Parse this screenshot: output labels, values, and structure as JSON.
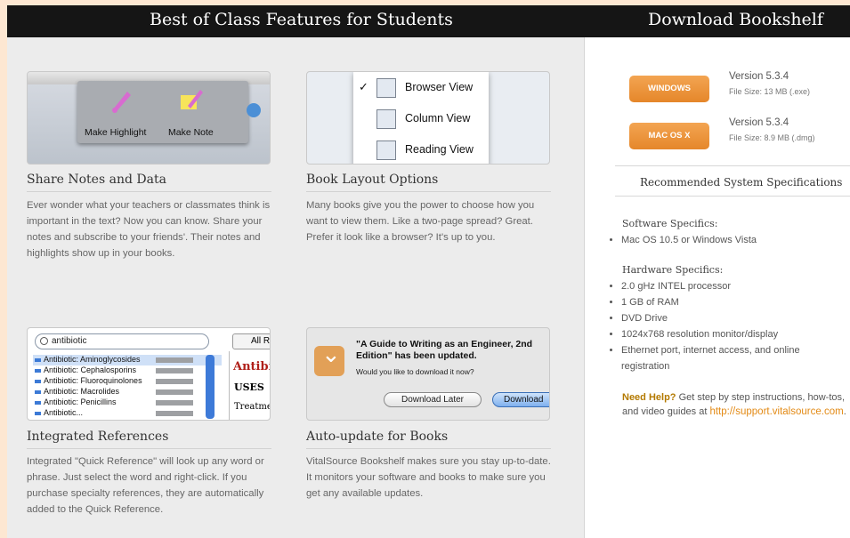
{
  "header": {
    "left_title": "Best of Class Features for Students",
    "right_title": "Download Bookshelf"
  },
  "features": [
    {
      "title": "Share Notes and Data",
      "description": "Ever wonder what your teachers or classmates think is important in the text? Now you can know. Share your notes and subscribe to your friends'. Their notes and highlights show up in your books.",
      "thumb": {
        "highlight_label": "Make Highlight",
        "note_label": "Make Note"
      }
    },
    {
      "title": "Book Layout Options",
      "description": "Many books give you the power to choose how you want to view them. Like a two-page spread? Great. Prefer it look like a browser? It's up to you.",
      "thumb": {
        "check": "✓",
        "items": [
          "Browser View",
          "Column View",
          "Reading View"
        ]
      }
    },
    {
      "title": "Integrated References",
      "description": "Integrated \"Quick Reference\" will look up any word or phrase. Just select the word and right-click. If you purchase specialty references, they are automatically added to the Quick Reference.",
      "thumb": {
        "search_value": "antibiotic",
        "all_button": "All R",
        "results": [
          "Antibiotic: Aminoglycosides",
          "Antibiotic: Cephalosporins",
          "Antibiotic: Fluoroquinolones",
          "Antibiotic: Macrolides",
          "Antibiotic: Penicillins",
          "Antibiotic..."
        ],
        "side_heading": "Antibioti",
        "side_uses": "USES",
        "side_treatment": "Treatment o"
      }
    },
    {
      "title": "Auto-update for Books",
      "description": "VitalSource Bookshelf makes sure you stay up-to-date. It monitors your software and books to make sure you get any available updates.",
      "thumb": {
        "dialog_title": "\"A Guide to Writing as an Engineer, 2nd Edition\" has been updated.",
        "question": "Would you like to download it now?",
        "later_button": "Download Later",
        "download_button": "Download"
      }
    }
  ],
  "downloads": [
    {
      "button": "WINDOWS",
      "version": "Version 5.3.4",
      "size": "File Size: 13 MB (.exe)"
    },
    {
      "button": "MAC OS X",
      "version": "Version 5.3.4",
      "size": "File Size: 8.9 MB (.dmg)"
    }
  ],
  "specs": {
    "heading": "Recommended System Specifications",
    "software_heading": "Software Specifics:",
    "software": [
      "Mac OS 10.5 or Windows Vista"
    ],
    "hardware_heading": "Hardware Specifics:",
    "hardware": [
      "2.0 gHz INTEL processor",
      "1 GB of RAM",
      "DVD Drive",
      "1024x768 resolution monitor/display",
      "Ethernet port, internet access, and online registration"
    ]
  },
  "help": {
    "label": "Need Help?",
    "text": " Get step by step instructions, how-tos, and video guides at ",
    "link": "http://support.vitalsource.com",
    "end": "."
  },
  "colors": {
    "accent": "#e98a2c",
    "header_bg": "#151515"
  }
}
